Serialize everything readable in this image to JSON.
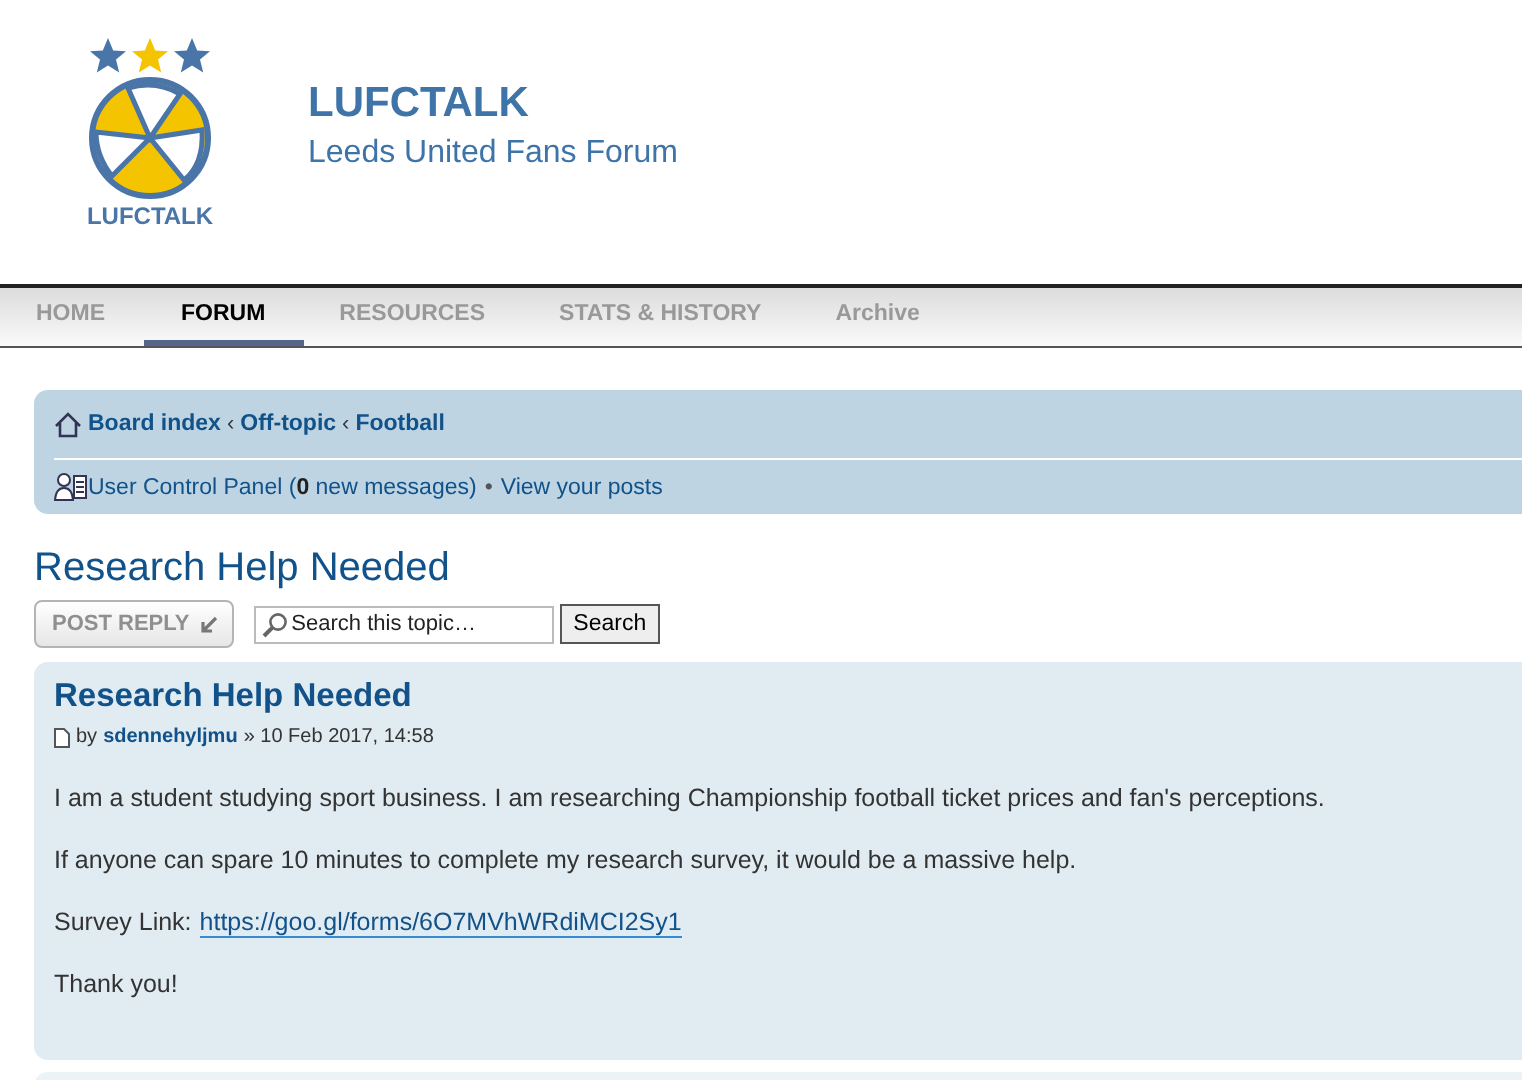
{
  "site": {
    "logo_text": "LUFCTALK",
    "title": "LUFCTALK",
    "subtitle": "Leeds United Fans Forum"
  },
  "nav": [
    {
      "label": "HOME",
      "selected": false
    },
    {
      "label": "FORUM",
      "selected": true
    },
    {
      "label": "RESOURCES",
      "selected": false
    },
    {
      "label": "STATS & HISTORY",
      "selected": false
    },
    {
      "label": "Archive",
      "selected": false
    }
  ],
  "breadcrumbs": [
    {
      "label": "Board index"
    },
    {
      "separator": "‹",
      "label": "Off-topic"
    },
    {
      "separator": "‹",
      "label": "Football"
    }
  ],
  "user_bar": {
    "text": "User Control Panel (**0** new messages)",
    "separator": "•",
    "link": "View your posts"
  },
  "topic_title": "Research Help Needed",
  "post_reply": "POST REPLY",
  "search": {
    "placeholder": "Search this topic…",
    "button": "Search"
  },
  "post": {
    "title": "Research Help Needed",
    "by": "by",
    "author": "sdennehyljmu",
    "date": "» 10 Feb 2017, 14:58",
    "body": [
      {
        "kind": "text",
        "text": "I am a student studying sport business. I am researching Championship football ticket prices and fan's perceptions."
      },
      {
        "kind": "text",
        "text": "If anyone can spare 10 minutes to complete my research survey, it would be a massive help."
      },
      {
        "kind": "link",
        "label": "Survey Link:",
        "link": "https://goo.gl/forms/6O7MVhWRdiMCI2Sy1"
      },
      {
        "kind": "text",
        "text": "Thank you!"
      }
    ]
  }
}
